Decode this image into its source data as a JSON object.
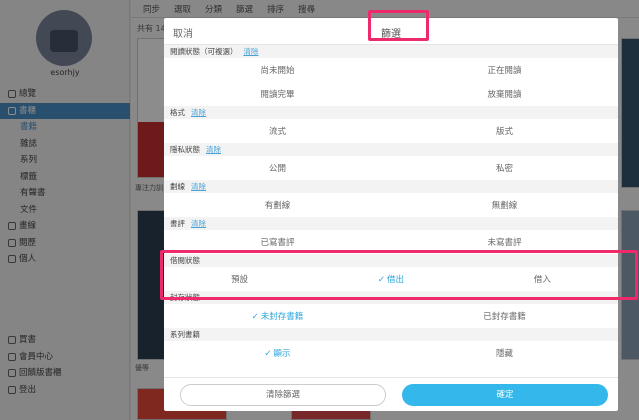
{
  "background": {
    "username": "esorhjy",
    "nav": [
      {
        "label": "總覽",
        "level": 0,
        "state": "normal"
      },
      {
        "label": "書櫃",
        "level": 0,
        "state": "active"
      },
      {
        "label": "書籍",
        "level": 1,
        "state": "active-sub"
      },
      {
        "label": "雜誌",
        "level": 1,
        "state": "normal"
      },
      {
        "label": "系列",
        "level": 1,
        "state": "normal"
      },
      {
        "label": "標籤",
        "level": 1,
        "state": "normal"
      },
      {
        "label": "有聲書",
        "level": 1,
        "state": "normal"
      },
      {
        "label": "文件",
        "level": 1,
        "state": "normal"
      },
      {
        "label": "畫線",
        "level": 0,
        "state": "normal"
      },
      {
        "label": "閱歷",
        "level": 0,
        "state": "normal"
      },
      {
        "label": "個人",
        "level": 0,
        "state": "normal"
      }
    ],
    "nav_bottom": [
      {
        "label": "買書"
      },
      {
        "label": "會員中心"
      },
      {
        "label": "回饋版書櫃"
      },
      {
        "label": "登出"
      }
    ],
    "toolbar": [
      "同步",
      "選取",
      "分類",
      "篩選",
      "排序",
      "搜尋"
    ],
    "count_label": "共有 14",
    "focus_label": "專注力訓",
    "cover_label": "優等"
  },
  "modal": {
    "cancel": "取消",
    "title": "篩選",
    "clear": "清除",
    "sections": [
      {
        "title": "閱讀狀態（可複選）",
        "rows": [
          [
            {
              "label": "尚未開始",
              "selected": false
            },
            {
              "label": "正在閱讀",
              "selected": false
            }
          ],
          [
            {
              "label": "閱讀完畢",
              "selected": false
            },
            {
              "label": "放棄閱讀",
              "selected": false
            }
          ]
        ]
      },
      {
        "title": "格式",
        "rows": [
          [
            {
              "label": "流式",
              "selected": false
            },
            {
              "label": "版式",
              "selected": false
            }
          ]
        ]
      },
      {
        "title": "隱私狀態",
        "rows": [
          [
            {
              "label": "公開",
              "selected": false
            },
            {
              "label": "私密",
              "selected": false
            }
          ]
        ]
      },
      {
        "title": "劃線",
        "rows": [
          [
            {
              "label": "有劃線",
              "selected": false
            },
            {
              "label": "無劃線",
              "selected": false
            }
          ]
        ]
      },
      {
        "title": "書評",
        "rows": [
          [
            {
              "label": "已寫書評",
              "selected": false
            },
            {
              "label": "未寫書評",
              "selected": false
            }
          ]
        ]
      },
      {
        "title": "借閱狀態",
        "no_clear": true,
        "rows": [
          [
            {
              "label": "預設",
              "selected": false
            },
            {
              "label": "借出",
              "selected": true
            },
            {
              "label": "借入",
              "selected": false
            }
          ]
        ]
      },
      {
        "title": "封存狀態",
        "no_clear": true,
        "rows": [
          [
            {
              "label": "未封存書籍",
              "selected": true
            },
            {
              "label": "已封存書籍",
              "selected": false
            }
          ]
        ]
      },
      {
        "title": "系列書籍",
        "no_clear": true,
        "rows": [
          [
            {
              "label": "顯示",
              "selected": true
            },
            {
              "label": "隱藏",
              "selected": false
            }
          ]
        ]
      }
    ],
    "reset_label": "清除篩選",
    "confirm_label": "確定"
  },
  "colors": {
    "accent": "#34b7ea",
    "selected_text": "#2aa6de",
    "highlight_box": "#ee2a6b",
    "sidebar_active": "#4a90c8"
  }
}
